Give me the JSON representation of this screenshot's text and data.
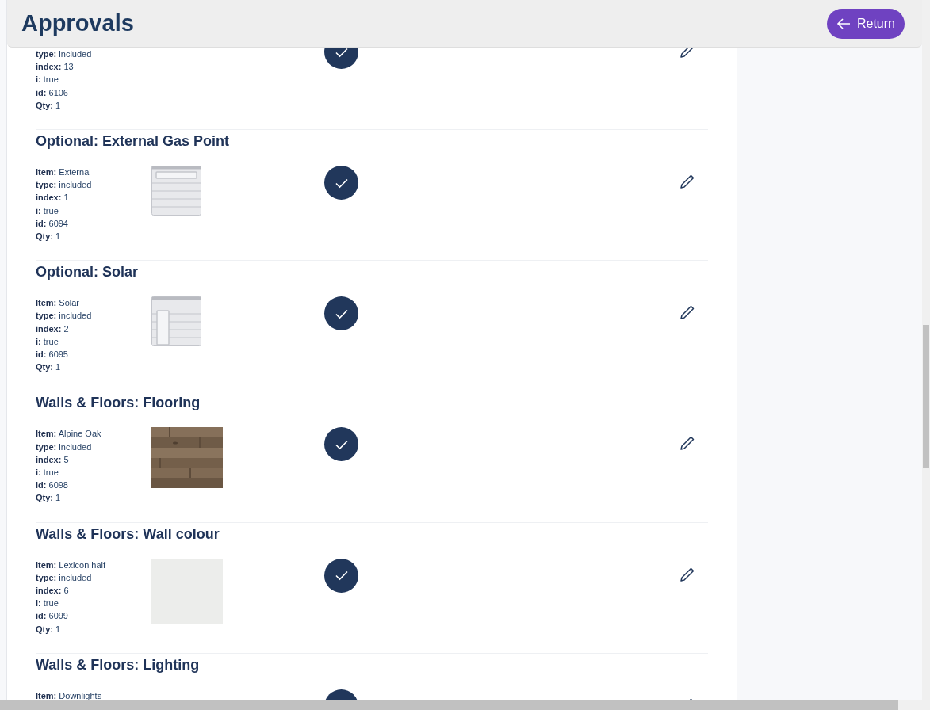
{
  "header": {
    "title": "Approvals",
    "return_button": "Return"
  },
  "sections": [
    {
      "fields": [
        {
          "label": "type:",
          "value": "included"
        },
        {
          "label": "index:",
          "value": "13"
        },
        {
          "label": "i:",
          "value": "true"
        },
        {
          "label": "id:",
          "value": "6106"
        },
        {
          "label": "Qty:",
          "value": "1"
        }
      ],
      "image": {
        "kind": "none"
      },
      "approved": true
    },
    {
      "title": "Optional: External Gas Point",
      "fields": [
        {
          "label": "Item:",
          "value": "External"
        },
        {
          "label": "type:",
          "value": "included"
        },
        {
          "label": "index:",
          "value": "1"
        },
        {
          "label": "i:",
          "value": "true"
        },
        {
          "label": "id:",
          "value": "6094"
        },
        {
          "label": "Qty:",
          "value": "1"
        }
      ],
      "image": {
        "kind": "placeholder-horizontal"
      },
      "approved": true
    },
    {
      "title": "Optional: Solar",
      "fields": [
        {
          "label": "Item:",
          "value": "Solar"
        },
        {
          "label": "type:",
          "value": "included"
        },
        {
          "label": "index:",
          "value": "2"
        },
        {
          "label": "i:",
          "value": "true"
        },
        {
          "label": "id:",
          "value": "6095"
        },
        {
          "label": "Qty:",
          "value": "1"
        }
      ],
      "image": {
        "kind": "placeholder-vertical"
      },
      "approved": true
    },
    {
      "title": "Walls & Floors: Flooring",
      "fields": [
        {
          "label": "Item:",
          "value": "Alpine Oak"
        },
        {
          "label": "type:",
          "value": "included"
        },
        {
          "label": "index:",
          "value": "5"
        },
        {
          "label": "i:",
          "value": "true"
        },
        {
          "label": "id:",
          "value": "6098"
        },
        {
          "label": "Qty:",
          "value": "1"
        }
      ],
      "approved": true
    },
    {
      "title": "Walls & Floors: Wall colour",
      "fields": [
        {
          "label": "Item:",
          "value": "Lexicon half"
        },
        {
          "label": "type:",
          "value": "included"
        },
        {
          "label": "index:",
          "value": "6"
        },
        {
          "label": "i:",
          "value": "true"
        },
        {
          "label": "id:",
          "value": "6099"
        },
        {
          "label": "Qty:",
          "value": "1"
        }
      ],
      "image": {
        "kind": "swatch",
        "color": "#ecedeb"
      },
      "approved": true
    },
    {
      "title": "Walls & Floors: Lighting",
      "fields": [
        {
          "label": "Item:",
          "value": "Downlights"
        }
      ],
      "image": {
        "kind": "none"
      },
      "approved": true
    }
  ]
}
